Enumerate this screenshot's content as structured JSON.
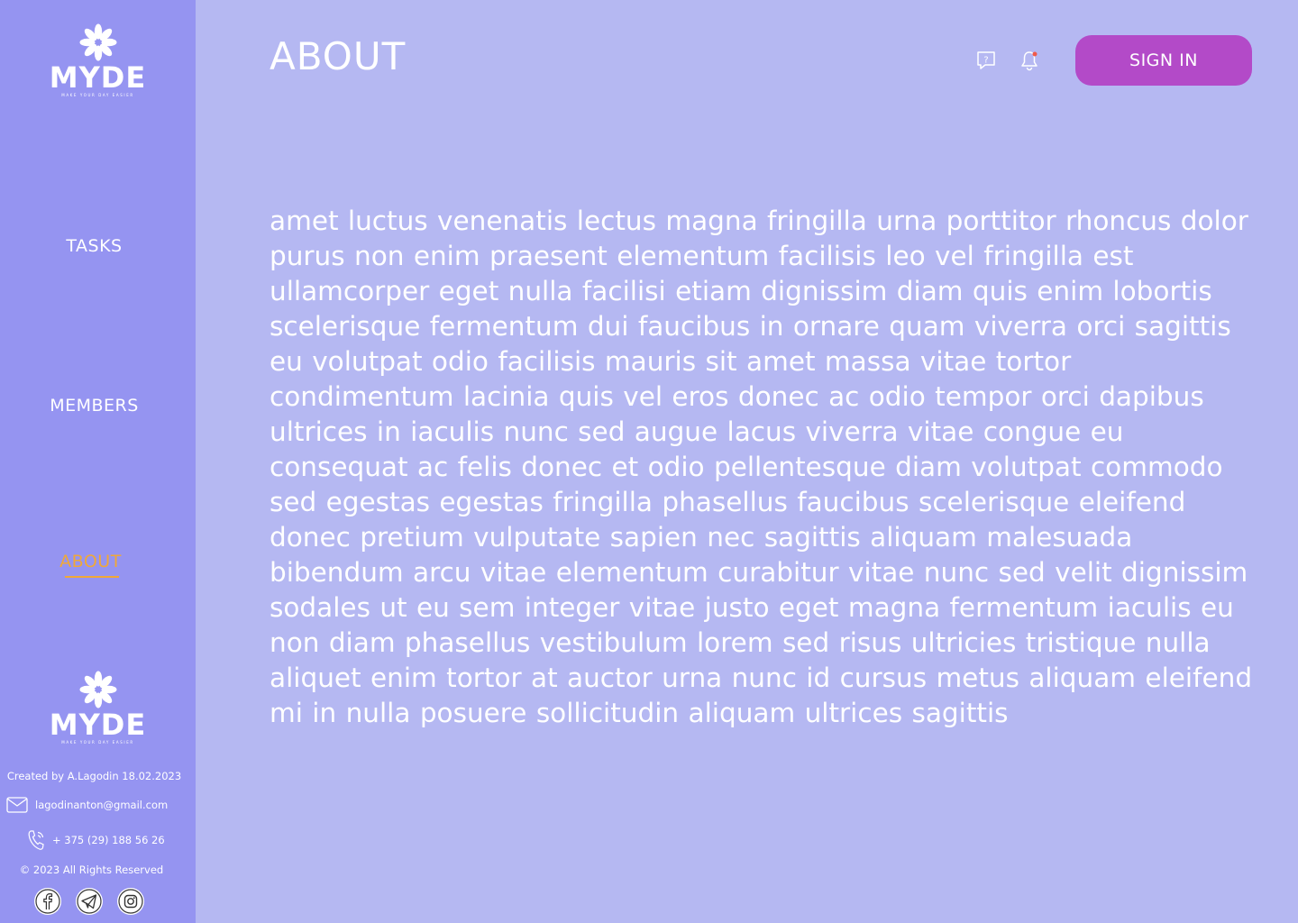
{
  "brand": {
    "name": "MYDE",
    "tagline": "MAKE YOUR DAY EASIER"
  },
  "nav": {
    "items": [
      {
        "label": "TASKS",
        "active": false
      },
      {
        "label": "MEMBERS",
        "active": false
      },
      {
        "label": "ABOUT",
        "active": true
      }
    ]
  },
  "header": {
    "title": "ABOUT",
    "help_icon": "help-chat-icon",
    "notification_icon": "bell-icon",
    "has_unread_notification": true,
    "sign_in_label": "SIGN IN"
  },
  "content": {
    "text": "amet luctus venenatis lectus magna fringilla urna porttitor rhoncus dolor purus non enim praesent elementum facilisis leo vel fringilla est ullamcorper eget nulla facilisi etiam dignissim diam quis enim lobortis scelerisque fermentum dui faucibus in ornare quam viverra orci sagittis eu volutpat odio facilisis mauris sit amet massa vitae tortor condimentum lacinia quis vel eros donec ac odio tempor orci dapibus ultrices in iaculis nunc sed augue lacus viverra vitae congue eu consequat ac felis donec et odio pellentesque diam volutpat commodo sed egestas egestas fringilla phasellus faucibus scelerisque eleifend donec pretium vulputate sapien nec sagittis aliquam malesuada bibendum arcu vitae elementum curabitur vitae nunc sed velit dignissim sodales ut eu sem integer vitae justo eget magna fermentum iaculis eu non diam phasellus vestibulum lorem sed risus ultricies tristique nulla aliquet enim tortor at auctor urna nunc id cursus metus aliquam eleifend mi in nulla posuere sollicitudin aliquam ultrices sagittis"
  },
  "footer": {
    "created_by": "Created by A.Lagodin 18.02.2023",
    "email": "lagodinanton@gmail.com",
    "phone": "+ 375 (29) 188 56 26",
    "copyright": "© 2023 All Rights Reserved",
    "socials": [
      "facebook-icon",
      "telegram-icon",
      "instagram-icon"
    ]
  },
  "colors": {
    "background": "#b5b8f2",
    "sidebar": "#9594f1",
    "accent": "#f0a838",
    "button": "#b34ac8",
    "notification_dot": "#f05a4a"
  }
}
